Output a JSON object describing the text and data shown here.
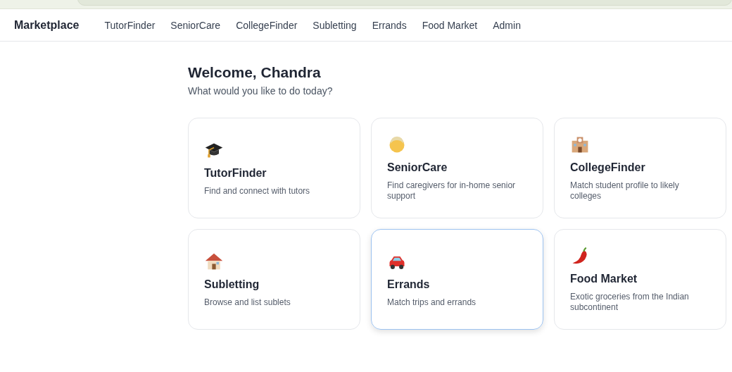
{
  "nav": {
    "brand": "Marketplace",
    "links": [
      "TutorFinder",
      "SeniorCare",
      "CollegeFinder",
      "Subletting",
      "Errands",
      "Food Market",
      "Admin"
    ]
  },
  "heading": "Welcome, Chandra",
  "subtitle": "What would you like to do today?",
  "cards": [
    {
      "title": "TutorFinder",
      "description": "Find and connect with tutors",
      "hovered": false
    },
    {
      "title": "SeniorCare",
      "description": "Find caregivers for in-home senior support",
      "hovered": false
    },
    {
      "title": "CollegeFinder",
      "description": "Match student profile to likely colleges",
      "hovered": false
    },
    {
      "title": "Subletting",
      "description": "Browse and list sublets",
      "hovered": false
    },
    {
      "title": "Errands",
      "description": "Match trips and errands",
      "hovered": true
    },
    {
      "title": "Food Market",
      "description": "Exotic groceries from the Indian subcontinent",
      "hovered": false
    }
  ]
}
